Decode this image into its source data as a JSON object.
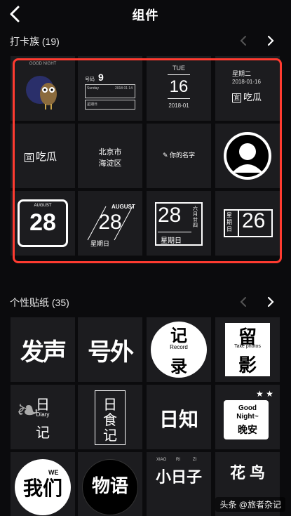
{
  "header": {
    "title": "组件"
  },
  "section1": {
    "title": "打卡族 (19)",
    "tiles": {
      "t2": {
        "weekday": "星期二",
        "date": "2018-01-16",
        "brand": "吃瓜",
        "brand_icon": "宜"
      },
      "t3": {
        "dow": "TUE",
        "day": "16",
        "ym": "2018-01"
      },
      "t4": {
        "week": "星期二",
        "date": "2018-01-16",
        "brand": "吃瓜",
        "brand_icon": "宜"
      },
      "t5": {
        "brand": "吃瓜",
        "brand_icon": "宜"
      },
      "t6": {
        "line1": "北京市",
        "line2": "海淀区"
      },
      "t7": {
        "name": "你的名字"
      },
      "t9": {
        "month": "AUGUST",
        "day": "28"
      },
      "t10": {
        "month": "AUGUST",
        "day": "28",
        "week": "星期日"
      },
      "t11": {
        "day": "28",
        "week": "星期日",
        "lunar": "六月廿四"
      },
      "t12": {
        "week": "星期日",
        "day": "26"
      },
      "t1": {
        "caption": "GOOD NIGHT"
      },
      "t2b": {
        "day": "9",
        "label": "号码",
        "small": "Sunday",
        "date": "2018 01 14",
        "week": "星期日"
      }
    }
  },
  "section2": {
    "title": "个性贴纸 (35)",
    "tiles": {
      "s1": {
        "text": "发声"
      },
      "s2": {
        "text": "号外"
      },
      "s3": {
        "top": "记",
        "mid": "Record",
        "bottom": "录"
      },
      "s4": {
        "top": "留",
        "mid": "Take photos",
        "bottom": "影"
      },
      "s5": {
        "top": "日",
        "mid": "Diary",
        "bottom": "记"
      },
      "s6": {
        "top": "日",
        "mid": "食",
        "bottom": "记"
      },
      "s7": {
        "text": "日知"
      },
      "s8": {
        "line1": "Good",
        "line2": "Night~",
        "line3": "晚安"
      },
      "s9": {
        "text": "我们",
        "badge": "WE"
      },
      "s10": {
        "text": "物语"
      },
      "s11": {
        "pinyin1": "XIAO",
        "pinyin2": "RI",
        "pinyin3": "ZI",
        "text": "小日子"
      },
      "s12": {
        "text": "花 鸟"
      }
    }
  },
  "watermark": {
    "text": "头条 @旅者杂记"
  }
}
